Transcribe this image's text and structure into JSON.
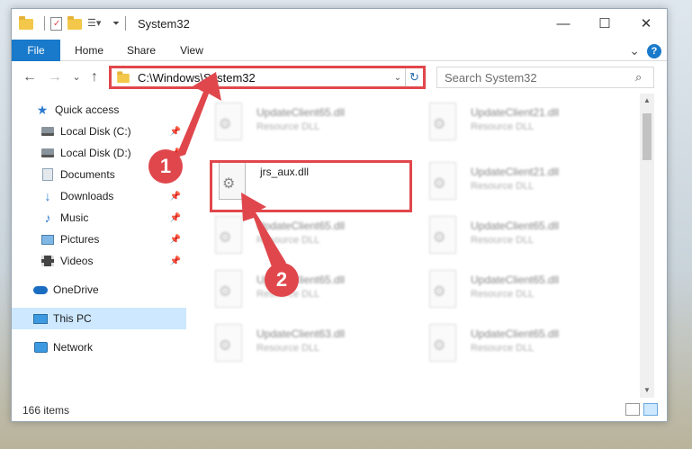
{
  "window": {
    "title": "System32",
    "controls": {
      "minimize": "—",
      "maximize": "☐",
      "close": "✕"
    }
  },
  "ribbon": {
    "tabs": [
      "File",
      "Home",
      "Share",
      "View"
    ],
    "expand_chevron": "⌄",
    "help": "?"
  },
  "nav": {
    "back": "←",
    "forward": "→",
    "recent": "⌄",
    "up": "↑"
  },
  "address": {
    "path": "C:\\Windows\\System32",
    "chevron": "⌄",
    "refresh": "↻"
  },
  "search": {
    "placeholder": "Search System32",
    "icon": "⌕"
  },
  "sidebar": {
    "items": [
      {
        "label": "Quick access",
        "icon": "star-icon"
      },
      {
        "label": "Local Disk (C:)",
        "icon": "drive-icon",
        "pinned": true
      },
      {
        "label": "Local Disk (D:)",
        "icon": "drive-icon",
        "pinned": true
      },
      {
        "label": "Documents",
        "icon": "documents-icon",
        "pinned": true
      },
      {
        "label": "Downloads",
        "icon": "download-icon",
        "pinned": true
      },
      {
        "label": "Music",
        "icon": "music-icon",
        "pinned": true
      },
      {
        "label": "Pictures",
        "icon": "pictures-icon",
        "pinned": true
      },
      {
        "label": "Videos",
        "icon": "videos-icon",
        "pinned": true
      },
      {
        "label": "OneDrive",
        "icon": "cloud-icon"
      },
      {
        "label": "This PC",
        "icon": "computer-icon",
        "selected": true
      },
      {
        "label": "Network",
        "icon": "network-icon"
      }
    ]
  },
  "files": [
    {
      "name": "UpdateClient65.dll",
      "type": "Resource DLL"
    },
    {
      "name": "UpdateClient21.dll",
      "type": "Resource DLL"
    },
    {
      "name": "jrs_aux.dll",
      "type": ""
    },
    {
      "name": "UpdateClient21.dll",
      "type": "Resource DLL"
    },
    {
      "name": "UpdateClient65.dll",
      "type": "Resource DLL"
    },
    {
      "name": "UpdateClient65.dll",
      "type": "Resource DLL"
    },
    {
      "name": "UpdateClient65.dll",
      "type": "Resource DLL"
    },
    {
      "name": "UpdateClient65.dll",
      "type": "Resource DLL"
    },
    {
      "name": "UpdateClient63.dll",
      "type": "Resource DLL"
    },
    {
      "name": "UpdateClient65.dll",
      "type": "Resource DLL"
    }
  ],
  "status": {
    "items_count": "166 items"
  },
  "callouts": [
    "1",
    "2"
  ],
  "colors": {
    "accent": "#1979ca",
    "highlight": "#e0474c",
    "selected_nav": "#cde8ff"
  }
}
